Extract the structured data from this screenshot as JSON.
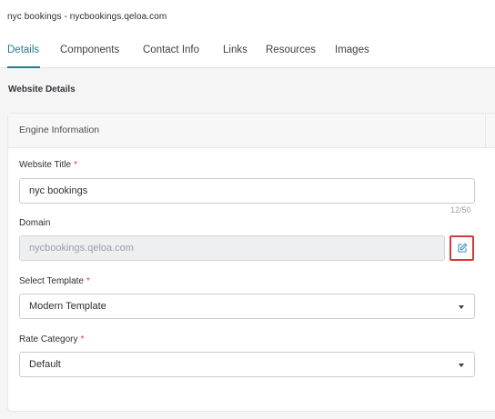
{
  "header": {
    "title": "nyc bookings - nycbookings.qeloa.com"
  },
  "tabs": [
    {
      "label": "Details"
    },
    {
      "label": "Components"
    },
    {
      "label": "Contact Info"
    },
    {
      "label": "Links"
    },
    {
      "label": "Resources"
    },
    {
      "label": "Images"
    }
  ],
  "active_tab": "Details",
  "section": {
    "title": "Website Details"
  },
  "card": {
    "title": "Engine Information",
    "website_title": {
      "label": "Website Title",
      "required_mark": "*",
      "value": "nyc bookings",
      "counter": "12/50"
    },
    "domain": {
      "label": "Domain",
      "value": "nycbookings.qeloa.com",
      "edit_icon": "edit-icon"
    },
    "template": {
      "label": "Select Template",
      "required_mark": "*",
      "value": "Modern Template"
    },
    "rate_category": {
      "label": "Rate Category",
      "required_mark": "*",
      "value": "Default"
    }
  },
  "colors": {
    "accent": "#2a7a8c",
    "required": "#e23b3b",
    "highlight_border": "#d63a36",
    "edit_icon": "#3d8fcf"
  }
}
